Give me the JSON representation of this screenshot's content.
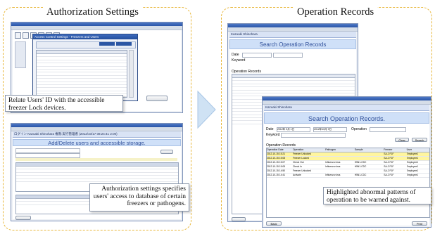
{
  "sections": {
    "left_title": "Authorization Settings",
    "right_title": "Operation Records"
  },
  "callouts": {
    "relate": "Relate Users' ID with the accessible freezer Lock devices.",
    "authorization": "Authorization settings specifies users' access to database of certain freezers or pathogens.",
    "highlight": "Highlighted abnormal patterns of operation to be warned against."
  },
  "app": {
    "user_header": "Kazuaki Shinohara",
    "user_header_full": "ログイン Kazuaki Shinohara 権限:実行管理者 (2012/10/17 08:24:41 2:00)",
    "access_dialog_title": "Access Control Settings - Freezers and Users",
    "add_delete_title": "Add/Delete users and accessible storage.",
    "search_title": "Search Operation Records.",
    "search_title_back": "Search Operation Records",
    "labels": {
      "date": "Date",
      "keyword": "Keyword",
      "operation": "Operation",
      "operation_records": "Operation Records",
      "clear": "Clear",
      "search": "Search",
      "back": "Back",
      "print": "Print",
      "date_from": "2012年 9月 1日",
      "date_to": "2012年10月 9日"
    },
    "columns": [
      "Operation Date",
      "Operation",
      "Pathogen",
      "Sample",
      "Freezer",
      "User"
    ],
    "records": [
      {
        "date": "2012-10-15 15:21",
        "op": "Freezer Unlocked",
        "pathogen": "",
        "sample": "",
        "freezer": "SA-2 F1F",
        "user": "Employee1",
        "hl": true
      },
      {
        "date": "2012-10-15 15:08",
        "op": "Freezer Locked",
        "pathogen": "",
        "sample": "",
        "freezer": "SA-2 F1F",
        "user": "Employee1",
        "hl": true
      },
      {
        "date": "2012-10-15 15:07",
        "op": "Check Out",
        "pathogen": "Influenza virus",
        "sample": "H5N1-CDC",
        "freezer": "SA-2 F1F",
        "user": "Employee1",
        "hl": false
      },
      {
        "date": "2012-10-15 15:05",
        "op": "Check In",
        "pathogen": "Influenza virus",
        "sample": "H5N1-CDC",
        "freezer": "SA-2 F1F",
        "user": "Employee1",
        "hl": false
      },
      {
        "date": "2012-10-15 14:50",
        "op": "Freezer Unlocked",
        "pathogen": "",
        "sample": "",
        "freezer": "SA-2 F1F",
        "user": "Employee1",
        "hl": false
      },
      {
        "date": "2012-10-15 14:41",
        "op": "Activate",
        "pathogen": "Influenza virus",
        "sample": "H5N1-CDC",
        "freezer": "SA-2 F1F",
        "user": "Employee1",
        "hl": false
      }
    ]
  }
}
